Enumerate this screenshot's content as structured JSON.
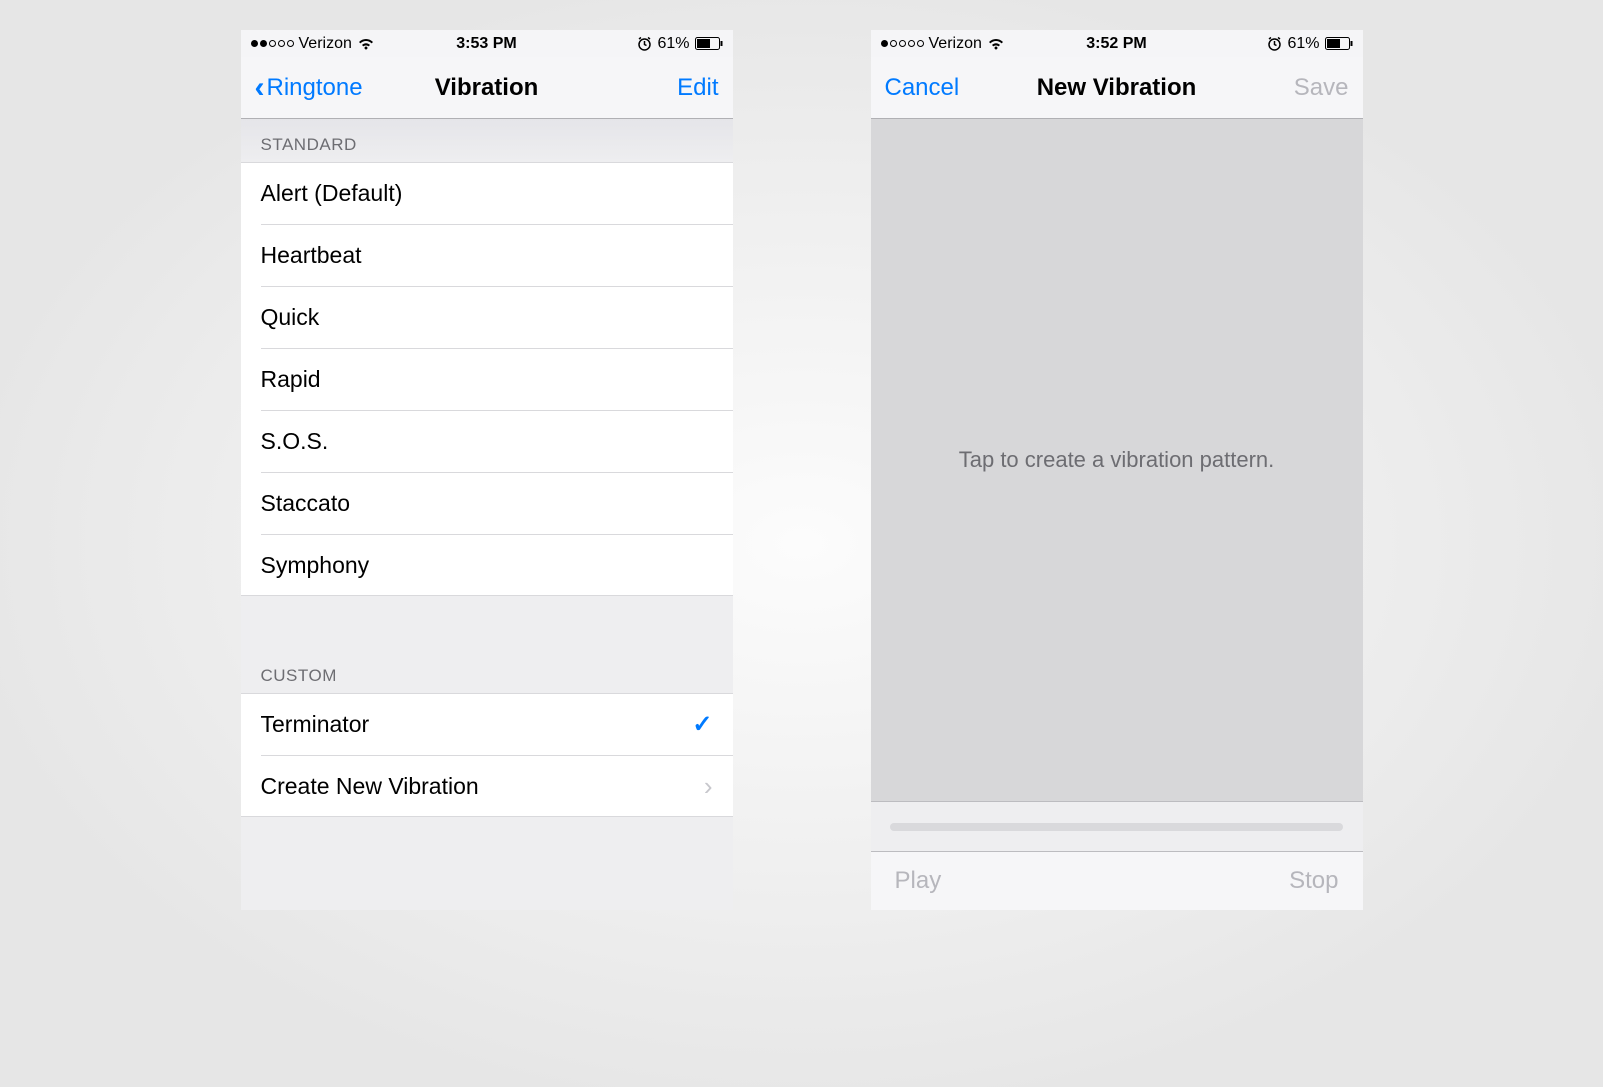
{
  "phones": [
    {
      "status": {
        "carrier": "Verizon",
        "time": "3:53 PM",
        "battery": "61%",
        "signal_filled": 2
      },
      "nav": {
        "back": "Ringtone",
        "title": "Vibration",
        "right": "Edit"
      },
      "sections": [
        {
          "header": "STANDARD",
          "items": [
            "Alert (Default)",
            "Heartbeat",
            "Quick",
            "Rapid",
            "S.O.S.",
            "Staccato",
            "Symphony"
          ]
        },
        {
          "header": "CUSTOM",
          "items_custom": [
            {
              "label": "Terminator",
              "checked": true
            },
            {
              "label": "Create New Vibration",
              "disclosure": true
            }
          ]
        }
      ]
    },
    {
      "status": {
        "carrier": "Verizon",
        "time": "3:52 PM",
        "battery": "61%",
        "signal_filled": 1
      },
      "nav": {
        "left": "Cancel",
        "title": "New Vibration",
        "right": "Save",
        "right_disabled": true
      },
      "tap_prompt": "Tap to create a vibration pattern.",
      "toolbar": {
        "play": "Play",
        "stop": "Stop"
      }
    }
  ]
}
